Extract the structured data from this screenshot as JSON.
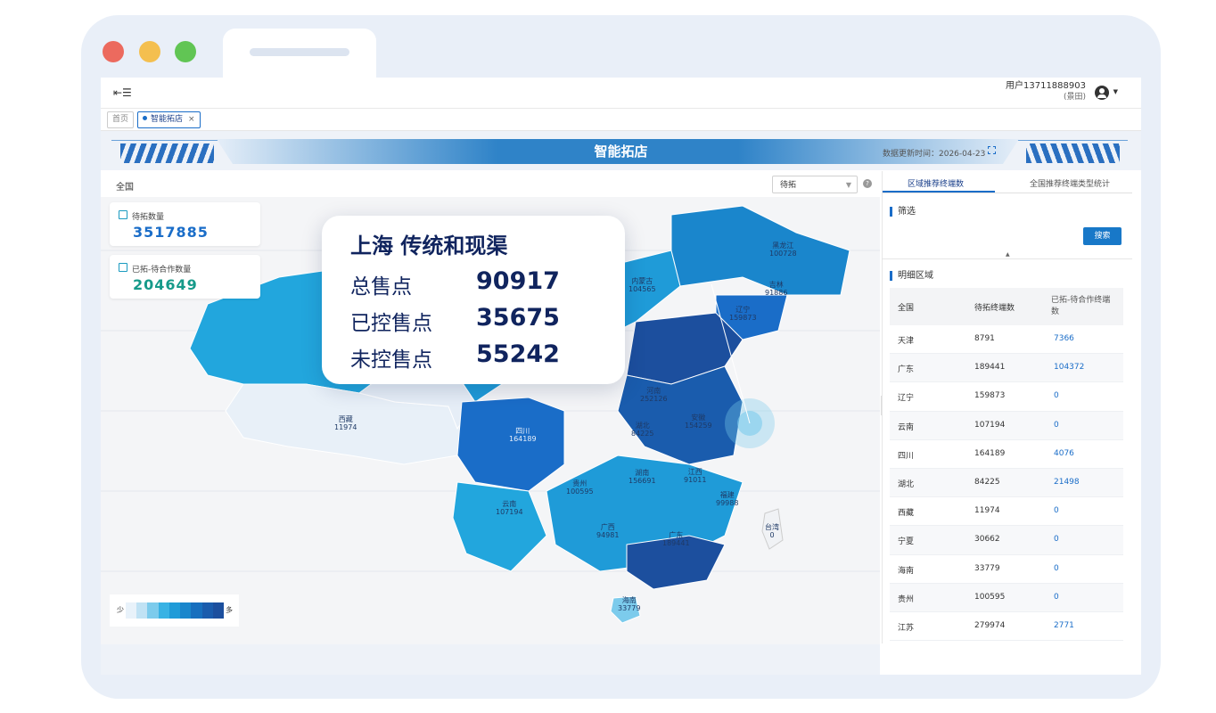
{
  "window": {
    "traffic_lights": [
      "#ec6a5e",
      "#f4bf4f",
      "#61c554"
    ]
  },
  "header": {
    "user_name": "用户13711888903",
    "user_org": "(景田)",
    "collapse_icon": "menu-collapse-icon",
    "avatar_icon": "user-avatar-icon"
  },
  "tags": [
    {
      "label": "首页",
      "active": false
    },
    {
      "label": "智能拓店",
      "active": true,
      "close": "×"
    }
  ],
  "banner": {
    "title": "智能拓店",
    "updated": "数据更新时间：2026-04-23"
  },
  "map_toolbar": {
    "scope": "全国",
    "select_value": "待拓",
    "help": "?"
  },
  "stats": [
    {
      "label": "待拓数量",
      "value": "3517885",
      "color": "#1a6dc8"
    },
    {
      "label": "已拓-待合作数量",
      "value": "204649",
      "color": "#169a8a"
    }
  ],
  "legend": {
    "low": "少",
    "high": "多",
    "ramp": [
      "#e8f2fa",
      "#c0e2f4",
      "#7ccbec",
      "#38b2e4",
      "#1f9bd8",
      "#1a86cc",
      "#176fbe",
      "#1a5cad",
      "#1c4f9e"
    ]
  },
  "map_labels": [
    {
      "name": "西藏",
      "value": "11974"
    },
    {
      "name": "四川",
      "value": "164189"
    },
    {
      "name": "湖北",
      "value": "84225"
    },
    {
      "name": "安徽",
      "value": "154259"
    },
    {
      "name": "湖南",
      "value": "156691"
    },
    {
      "name": "江西",
      "value": "91011"
    },
    {
      "name": "贵州",
      "value": "100595"
    },
    {
      "name": "云南",
      "value": "107194"
    },
    {
      "name": "广西",
      "value": "94981"
    },
    {
      "name": "广东",
      "value": "189441"
    },
    {
      "name": "福建",
      "value": "99988"
    },
    {
      "name": "海南",
      "value": "33779"
    },
    {
      "name": "河南",
      "value": "252126"
    },
    {
      "name": "辽宁",
      "value": "159873"
    },
    {
      "name": "吉林",
      "value": "91886"
    },
    {
      "name": "黑龙江",
      "value": "100728"
    },
    {
      "name": "内蒙古",
      "value": "104565"
    },
    {
      "name": "台湾",
      "value": "0"
    }
  ],
  "popup": {
    "title": "上海 传统和现渠",
    "rows": [
      {
        "label": "总售点",
        "value": "90917"
      },
      {
        "label": "已控售点",
        "value": "35675"
      },
      {
        "label": "未控售点",
        "value": "55242"
      }
    ]
  },
  "right_panel": {
    "tabs": [
      "区域推荐终端数",
      "全国推荐终端类型统计"
    ],
    "filter_title": "筛选",
    "search_label": "搜索",
    "detail_title": "明细区域",
    "columns": [
      "全国",
      "待拓终端数",
      "已拓-待合作终端数"
    ],
    "rows": [
      [
        "天津",
        "8791",
        "7366"
      ],
      [
        "广东",
        "189441",
        "104372"
      ],
      [
        "辽宁",
        "159873",
        "0"
      ],
      [
        "云南",
        "107194",
        "0"
      ],
      [
        "四川",
        "164189",
        "4076"
      ],
      [
        "湖北",
        "84225",
        "21498"
      ],
      [
        "西藏",
        "11974",
        "0"
      ],
      [
        "宁夏",
        "30662",
        "0"
      ],
      [
        "海南",
        "33779",
        "0"
      ],
      [
        "贵州",
        "100595",
        "0"
      ],
      [
        "江苏",
        "279974",
        "2771"
      ]
    ]
  }
}
